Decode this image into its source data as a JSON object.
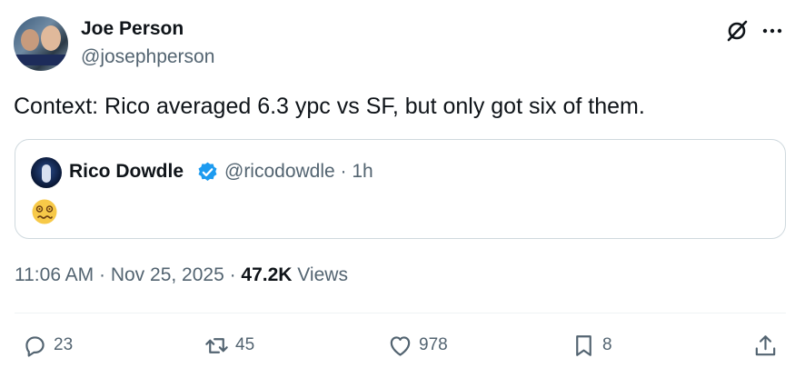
{
  "author": {
    "display_name": "Joe Person",
    "handle": "@josephperson"
  },
  "tweet": {
    "text": "Context: Rico averaged 6.3 ypc vs SF, but only got six of them."
  },
  "quoted": {
    "display_name": "Rico Dowdle",
    "handle_time": "@ricodowdle · 1h",
    "emoji": "woozy-face-icon",
    "verified_color": "#1d9bf0"
  },
  "meta": {
    "timestamp": "11:06 AM · Nov 25, 2025 · ",
    "views_count": "47.2K",
    "views_label": " Views"
  },
  "actions": {
    "replies": "23",
    "reposts": "45",
    "likes": "978",
    "bookmarks": "8"
  },
  "colors": {
    "text": "#0f1419",
    "secondary": "#536471",
    "border": "#cfd9de"
  }
}
